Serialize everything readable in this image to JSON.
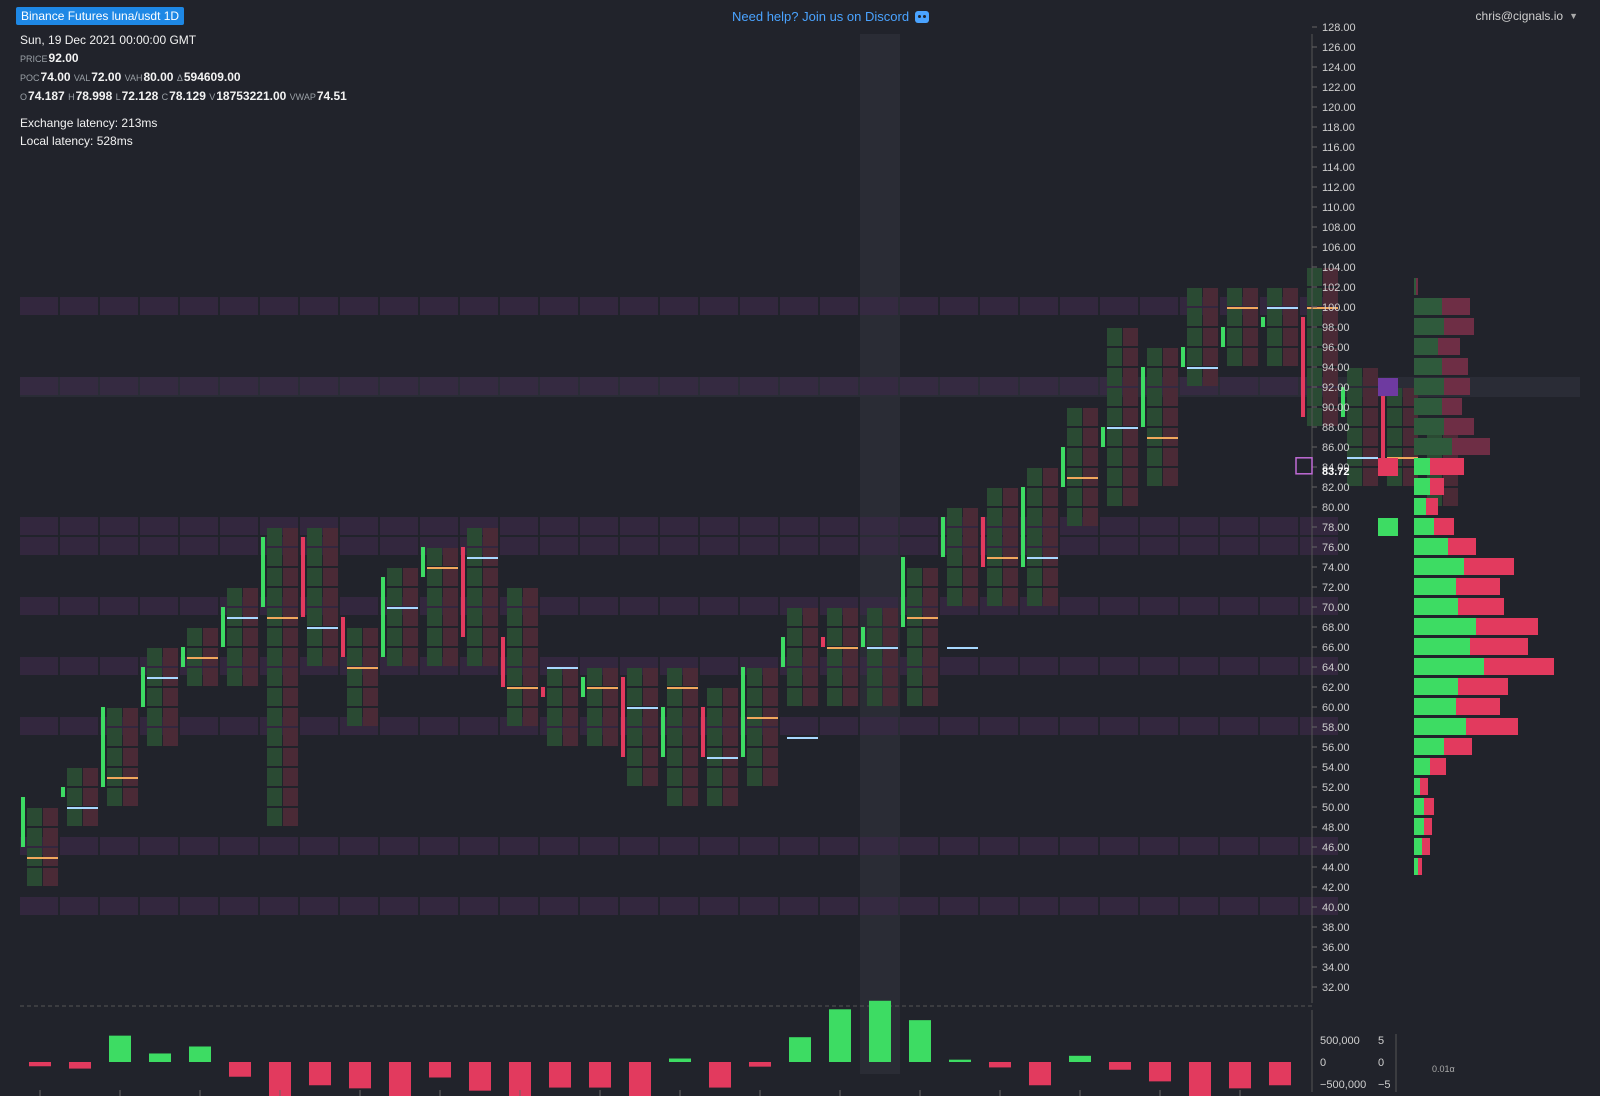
{
  "header": {
    "symbol_badge": "Binance Futures luna/usdt 1D",
    "discord_text": "Need help? Join us on Discord",
    "user": "chris@cignals.io"
  },
  "info": {
    "datetime": "Sun, 19 Dec 2021 00:00:00 GMT",
    "price_label": "PRICE",
    "price": "92.00",
    "poc_label": "POC",
    "poc": "74.00",
    "val_label": "VAL",
    "val": "72.00",
    "vah_label": "VAH",
    "vah": "80.00",
    "delta_label": "Δ",
    "delta": "594609.00",
    "o_label": "O",
    "o": "74.187",
    "h_label": "H",
    "h": "78.998",
    "l_label": "L",
    "l": "72.128",
    "c_label": "C",
    "c": "78.129",
    "v_label": "V",
    "v": "18753221.00",
    "vwap_label": "VWAP",
    "vwap": "74.51",
    "exchange_latency": "Exchange latency: 213ms",
    "local_latency": "Local latency: 528ms"
  },
  "colors": {
    "bg": "#21232b",
    "up": "#3ddc63",
    "down": "#e23a5e",
    "up_dark": "#2a4a33",
    "down_dark": "#4a2a36",
    "band": "#3a2a45",
    "accent": "#1e88e5"
  },
  "chart_data": {
    "type": "footprint",
    "y_axis": {
      "ticks": [
        "128.00",
        "126.00",
        "124.00",
        "122.00",
        "120.00",
        "118.00",
        "116.00",
        "114.00",
        "112.00",
        "110.00",
        "108.00",
        "106.00",
        "104.00",
        "102.00",
        "100.00",
        "98.00",
        "96.00",
        "94.00",
        "92.00",
        "90.00",
        "88.00",
        "86.00",
        "84.00",
        "82.00",
        "80.00",
        "78.00",
        "76.00",
        "74.00",
        "72.00",
        "70.00",
        "68.00",
        "66.00",
        "64.00",
        "62.00",
        "60.00",
        "58.00",
        "56.00",
        "54.00",
        "52.00",
        "50.00",
        "48.00",
        "46.00",
        "44.00",
        "42.00",
        "40.00",
        "38.00",
        "36.00",
        "34.00",
        "32.00"
      ],
      "range": [
        31,
        129
      ],
      "current_price_label": "83.72",
      "current_price": 83.72
    },
    "candles": [
      {
        "o": 46,
        "h": 51,
        "l": 43,
        "c": 51,
        "poc": 45
      },
      {
        "o": 51,
        "h": 55,
        "l": 48,
        "c": 52,
        "poc": 50
      },
      {
        "o": 52,
        "h": 61,
        "l": 51,
        "c": 60,
        "poc": 53
      },
      {
        "o": 60,
        "h": 67,
        "l": 56,
        "c": 64,
        "poc": 63
      },
      {
        "o": 64,
        "h": 69,
        "l": 62,
        "c": 66,
        "poc": 65
      },
      {
        "o": 66,
        "h": 73,
        "l": 63,
        "c": 70,
        "poc": 69
      },
      {
        "o": 70,
        "h": 79,
        "l": 49,
        "c": 77,
        "poc": 69
      },
      {
        "o": 77,
        "h": 79,
        "l": 65,
        "c": 69,
        "poc": 68
      },
      {
        "o": 69,
        "h": 69,
        "l": 59,
        "c": 65,
        "poc": 64
      },
      {
        "o": 65,
        "h": 75,
        "l": 65,
        "c": 73,
        "poc": 70
      },
      {
        "o": 73,
        "h": 77,
        "l": 65,
        "c": 76,
        "poc": 74
      },
      {
        "o": 76,
        "h": 79,
        "l": 65,
        "c": 67,
        "poc": 75
      },
      {
        "o": 67,
        "h": 73,
        "l": 59,
        "c": 62,
        "poc": 62
      },
      {
        "o": 62,
        "h": 65,
        "l": 57,
        "c": 61,
        "poc": 64
      },
      {
        "o": 61,
        "h": 65,
        "l": 57,
        "c": 63,
        "poc": 62
      },
      {
        "o": 63,
        "h": 65,
        "l": 53,
        "c": 55,
        "poc": 60
      },
      {
        "o": 55,
        "h": 65,
        "l": 51,
        "c": 60,
        "poc": 62
      },
      {
        "o": 60,
        "h": 63,
        "l": 51,
        "c": 55,
        "poc": 55
      },
      {
        "o": 55,
        "h": 65,
        "l": 53,
        "c": 64,
        "poc": 59
      },
      {
        "o": 64,
        "h": 71,
        "l": 61,
        "c": 67,
        "poc": 57
      },
      {
        "o": 67,
        "h": 71,
        "l": 61,
        "c": 66,
        "poc": 66
      },
      {
        "o": 66,
        "h": 71,
        "l": 61,
        "c": 68,
        "poc": 66
      },
      {
        "o": 68,
        "h": 75,
        "l": 61,
        "c": 75,
        "poc": 69
      },
      {
        "o": 75,
        "h": 81,
        "l": 71,
        "c": 79,
        "poc": 66
      },
      {
        "o": 79,
        "h": 83,
        "l": 71,
        "c": 74,
        "poc": 75
      },
      {
        "o": 74,
        "h": 85,
        "l": 71,
        "c": 82,
        "poc": 75
      },
      {
        "o": 82,
        "h": 91,
        "l": 79,
        "c": 86,
        "poc": 83
      },
      {
        "o": 86,
        "h": 99,
        "l": 81,
        "c": 88,
        "poc": 88
      },
      {
        "o": 88,
        "h": 97,
        "l": 83,
        "c": 94,
        "poc": 87
      },
      {
        "o": 94,
        "h": 103,
        "l": 93,
        "c": 96,
        "poc": 94
      },
      {
        "o": 96,
        "h": 103,
        "l": 95,
        "c": 98,
        "poc": 100
      },
      {
        "o": 98,
        "h": 103,
        "l": 95,
        "c": 99,
        "poc": 100
      },
      {
        "o": 99,
        "h": 105,
        "l": 91,
        "c": 89,
        "poc": 100
      },
      {
        "o": 89,
        "h": 95,
        "l": 83,
        "c": 92,
        "poc": 85
      },
      {
        "o": 92,
        "h": 89,
        "l": 82,
        "c": 84,
        "poc": 85
      },
      {
        "o": 84,
        "h": 89,
        "l": 81,
        "c": 84,
        "poc": 84
      }
    ],
    "bands": [
      {
        "low": 41,
        "high": 39
      },
      {
        "low": 45,
        "high": 47
      },
      {
        "low": 57,
        "high": 59
      },
      {
        "low": 63,
        "high": 65
      },
      {
        "low": 69,
        "high": 71
      },
      {
        "low": 75,
        "high": 77
      },
      {
        "low": 77,
        "high": 79
      },
      {
        "low": 91,
        "high": 93
      },
      {
        "low": 99,
        "high": 101
      }
    ],
    "volume_profile": [
      {
        "price": 102,
        "buy": 1,
        "sell": 1
      },
      {
        "price": 100,
        "buy": 14,
        "sell": 14
      },
      {
        "price": 98,
        "buy": 15,
        "sell": 15
      },
      {
        "price": 96,
        "buy": 12,
        "sell": 11
      },
      {
        "price": 94,
        "buy": 14,
        "sell": 13
      },
      {
        "price": 92,
        "buy": 15,
        "sell": 13
      },
      {
        "price": 90,
        "buy": 14,
        "sell": 10
      },
      {
        "price": 88,
        "buy": 15,
        "sell": 15
      },
      {
        "price": 86,
        "buy": 19,
        "sell": 19
      },
      {
        "price": 84,
        "buy": 8,
        "sell": 17
      },
      {
        "price": 82,
        "buy": 8,
        "sell": 7
      },
      {
        "price": 80,
        "buy": 6,
        "sell": 6
      },
      {
        "price": 78,
        "buy": 10,
        "sell": 10
      },
      {
        "price": 76,
        "buy": 17,
        "sell": 14
      },
      {
        "price": 74,
        "buy": 25,
        "sell": 25
      },
      {
        "price": 72,
        "buy": 21,
        "sell": 22
      },
      {
        "price": 70,
        "buy": 22,
        "sell": 23
      },
      {
        "price": 68,
        "buy": 31,
        "sell": 31
      },
      {
        "price": 66,
        "buy": 28,
        "sell": 29
      },
      {
        "price": 64,
        "buy": 35,
        "sell": 35
      },
      {
        "price": 62,
        "buy": 22,
        "sell": 25
      },
      {
        "price": 60,
        "buy": 21,
        "sell": 22
      },
      {
        "price": 58,
        "buy": 26,
        "sell": 26
      },
      {
        "price": 56,
        "buy": 15,
        "sell": 14
      },
      {
        "price": 54,
        "buy": 8,
        "sell": 8
      },
      {
        "price": 52,
        "buy": 3,
        "sell": 4
      },
      {
        "price": 50,
        "buy": 5,
        "sell": 5
      },
      {
        "price": 48,
        "buy": 5,
        "sell": 4
      },
      {
        "price": 46,
        "buy": 4,
        "sell": 4
      },
      {
        "price": 44,
        "buy": 2,
        "sell": 2
      }
    ],
    "delta_bars": [
      -55000,
      -85000,
      340000,
      110000,
      200000,
      -190000,
      -560000,
      -300000,
      -340000,
      -730000,
      -200000,
      -370000,
      -590000,
      -330000,
      -330000,
      -680000,
      45000,
      -330000,
      -60000,
      320000,
      680000,
      790000,
      540000,
      30000,
      -70000,
      -300000,
      80000,
      -100000,
      -250000,
      -440000,
      -340000,
      -300000
    ],
    "delta_axis": {
      "ticks": [
        "500,000",
        "0",
        "−500,000"
      ],
      "range": [
        -800000,
        800000
      ]
    },
    "right_axis": {
      "ticks": [
        "5",
        "0",
        "−5"
      ]
    },
    "scale_label": "0.01α"
  }
}
